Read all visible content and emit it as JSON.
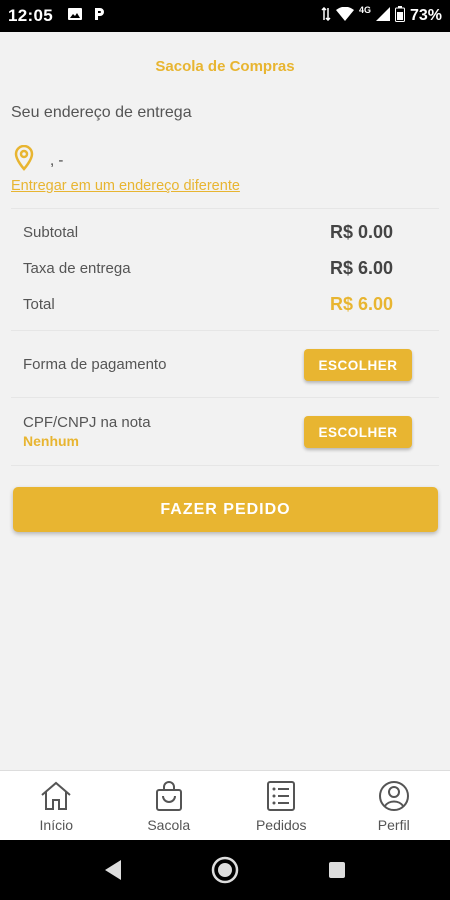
{
  "status_bar": {
    "time": "12:05",
    "network": "4G",
    "battery": "73%"
  },
  "header": {
    "title": "Sacola de Compras"
  },
  "delivery": {
    "title": "Seu endereço de entrega",
    "address": ", -",
    "alt_link": "Entregar em um endereço diferente"
  },
  "totals": {
    "subtotal_label": "Subtotal",
    "subtotal_value": "R$ 0.00",
    "fee_label": "Taxa de entrega",
    "fee_value": "R$ 6.00",
    "total_label": "Total",
    "total_value": "R$ 6.00"
  },
  "payment": {
    "label": "Forma de pagamento",
    "button": "ESCOLHER"
  },
  "tax_id": {
    "label": "CPF/CNPJ na nota",
    "value": "Nenhum",
    "button": "ESCOLHER"
  },
  "order_button": "FAZER PEDIDO",
  "bottom_nav": {
    "items": [
      {
        "label": "Início",
        "icon": "home-icon"
      },
      {
        "label": "Sacola",
        "icon": "bag-icon"
      },
      {
        "label": "Pedidos",
        "icon": "list-icon"
      },
      {
        "label": "Perfil",
        "icon": "profile-icon"
      }
    ]
  },
  "colors": {
    "accent": "#e8b531",
    "background": "#f2f2f2"
  }
}
